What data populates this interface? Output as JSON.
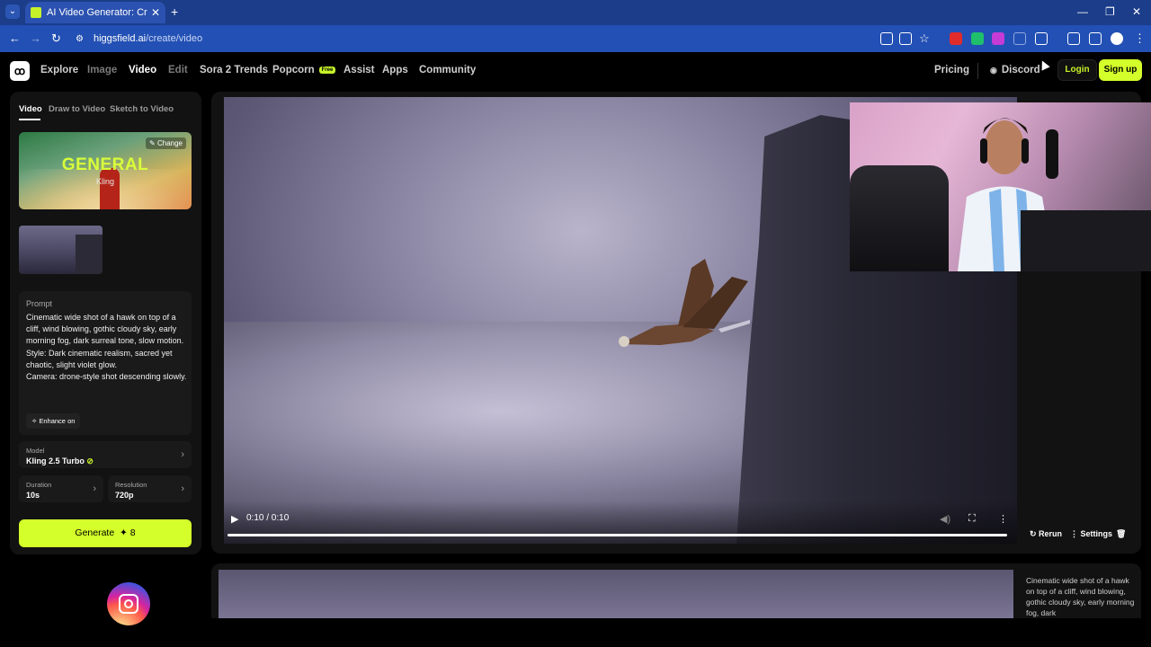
{
  "browser": {
    "tab_title": "AI Video Generator: Create stun",
    "url_domain": "higgsfield.ai",
    "url_path": "/create/video"
  },
  "header": {
    "nav": [
      "Explore",
      "Image",
      "Video",
      "Edit",
      "Sora 2 Trends",
      "Popcorn",
      "Assist",
      "Apps",
      "Community"
    ],
    "free_badge": "Free",
    "pricing": "Pricing",
    "discord": "Discord",
    "login": "Login",
    "signup": "Sign up"
  },
  "panel": {
    "tabs": [
      "Video",
      "Draw to Video",
      "Sketch to Video"
    ],
    "preset_title": "GENERAL",
    "preset_sub": "Kling",
    "change": "Change",
    "prompt_label": "Prompt",
    "prompt_text": "Cinematic wide shot of a hawk on top of a cliff, wind blowing, gothic cloudy sky, early morning fog, dark surreal tone, slow motion.\nStyle: Dark cinematic realism, sacred yet chaotic, slight violet glow.\nCamera: drone-style shot descending slowly.",
    "enhance": "Enhance on",
    "model_label": "Model",
    "model_value": "Kling 2.5 Turbo",
    "duration_label": "Duration",
    "duration_value": "10s",
    "resolution_label": "Resolution",
    "resolution_value": "720p",
    "generate": "Generate",
    "credits": "8"
  },
  "player": {
    "time": "0:10 / 0:10",
    "progress": 1.0
  },
  "actions": {
    "rerun": "Rerun",
    "settings": "Settings"
  },
  "second_card": {
    "desc": "Cinematic wide shot of a hawk on top of a cliff, wind blowing, gothic cloudy sky, early morning fog, dark"
  },
  "colors": {
    "accent": "#d4ff2a",
    "tabbar": "#1b3d8a",
    "addrbar": "#2350b4"
  }
}
